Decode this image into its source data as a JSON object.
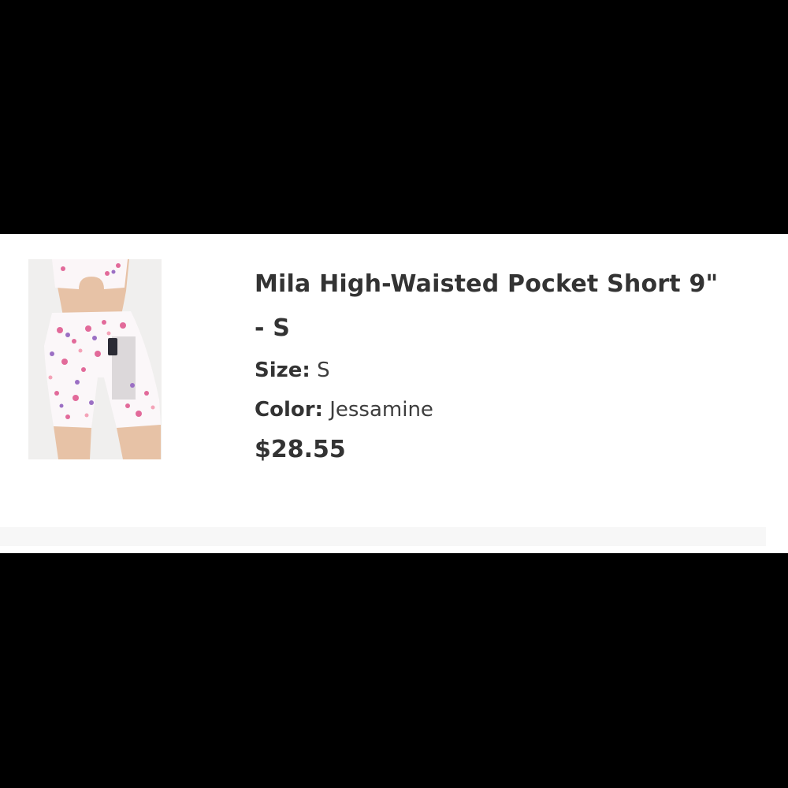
{
  "product": {
    "name": "Mila High-Waisted Pocket Short 9\" - S",
    "size_label": "Size:",
    "size_value": "S",
    "color_label": "Color:",
    "color_value": "Jessamine",
    "price": "$28.55",
    "image_icon": "product-photo-floral-shorts"
  },
  "colors": {
    "background": "#000000",
    "card": "#ffffff",
    "text": "#333333",
    "floral_pink": "#e26a9a",
    "floral_purple": "#9b6fc4"
  }
}
